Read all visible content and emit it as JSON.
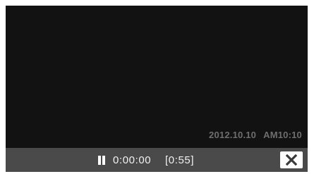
{
  "overlay": {
    "date": "2012.10.10",
    "time": "AM10:10"
  },
  "controls": {
    "pause_icon": "pause-icon",
    "elapsed_time": "0:00:00",
    "total_duration": "[0:55]",
    "close_icon": "close-icon"
  },
  "colors": {
    "background": "#121212",
    "control_bar": "#4a4a4a",
    "timestamp_text": "#6e6e6e",
    "control_text": "#f2f2f2",
    "close_button_bg": "#ffffff"
  }
}
